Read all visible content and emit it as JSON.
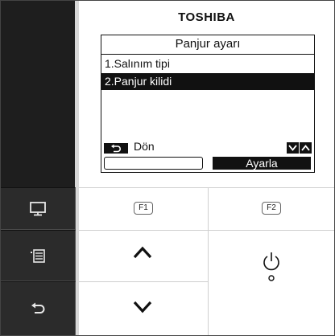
{
  "brand": "TOSHIBA",
  "screen": {
    "title": "Panjur ayarı",
    "items": [
      {
        "label": "1.Salınım tipi",
        "selected": false
      },
      {
        "label": "2.Panjur kilidi",
        "selected": true
      }
    ],
    "back_label": "Dön",
    "soft_right_label": "Ayarla"
  },
  "keys": {
    "f1": "F1",
    "f2": "F2"
  },
  "icons": {
    "left1": "monitor-icon",
    "left2": "menu-list-icon",
    "left3": "return-icon",
    "up": "chevron-up-icon",
    "down": "chevron-down-icon",
    "power": "power-icon"
  }
}
